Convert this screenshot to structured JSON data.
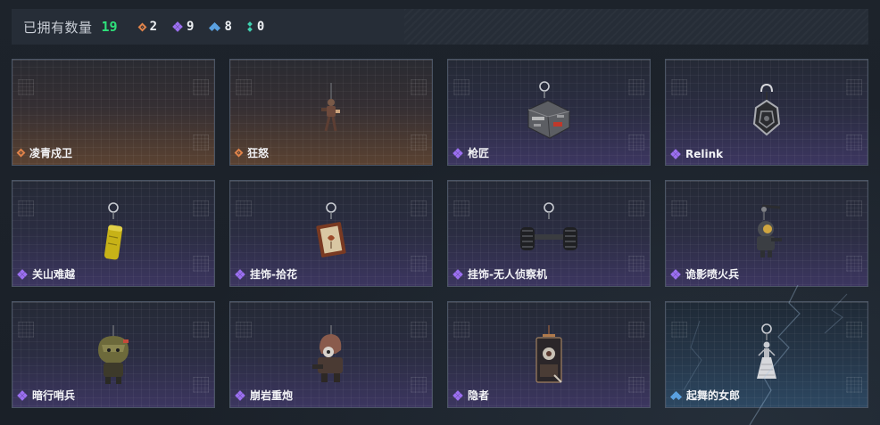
{
  "summary": {
    "label": "已拥有数量",
    "total": "19",
    "total_color": "#2ee07a",
    "rarities": [
      {
        "icon": "orange-diamond-icon",
        "color": "#e0834a",
        "count": "2"
      },
      {
        "icon": "purple-quad-icon",
        "color": "#9b6ff0",
        "count": "9"
      },
      {
        "icon": "blue-chevron-icon",
        "color": "#5aa0e0",
        "count": "8"
      },
      {
        "icon": "green-dots-icon",
        "color": "#3fd0b0",
        "count": "0"
      }
    ]
  },
  "items": [
    {
      "name": "凌青戍卫",
      "rarity": "orange",
      "icon": "empty"
    },
    {
      "name": "狂怒",
      "rarity": "orange",
      "icon": "charm-figure-icon"
    },
    {
      "name": "枪匠",
      "rarity": "purple",
      "icon": "charm-gunsmith-icon"
    },
    {
      "name": "Relink",
      "rarity": "purple",
      "icon": "charm-relink-icon"
    },
    {
      "name": "关山难越",
      "rarity": "purple",
      "icon": "charm-yellow-canister-icon"
    },
    {
      "name": "挂饰-拾花",
      "rarity": "purple",
      "icon": "charm-flower-card-icon"
    },
    {
      "name": "挂饰-无人侦察机",
      "rarity": "purple",
      "icon": "charm-drone-icon"
    },
    {
      "name": "诡影喷火兵",
      "rarity": "purple",
      "icon": "charm-flamethrower-icon"
    },
    {
      "name": "暗行哨兵",
      "rarity": "purple",
      "icon": "charm-sentinel-icon"
    },
    {
      "name": "崩岩重炮",
      "rarity": "purple",
      "icon": "charm-heavy-gunner-icon"
    },
    {
      "name": "隐者",
      "rarity": "purple",
      "icon": "charm-hermit-card-icon"
    },
    {
      "name": "起舞的女郎",
      "rarity": "blue",
      "icon": "charm-dancer-icon"
    }
  ],
  "rarity_colors": {
    "orange": "#e0834a",
    "purple": "#9b6ff0",
    "blue": "#5aa0e0"
  }
}
